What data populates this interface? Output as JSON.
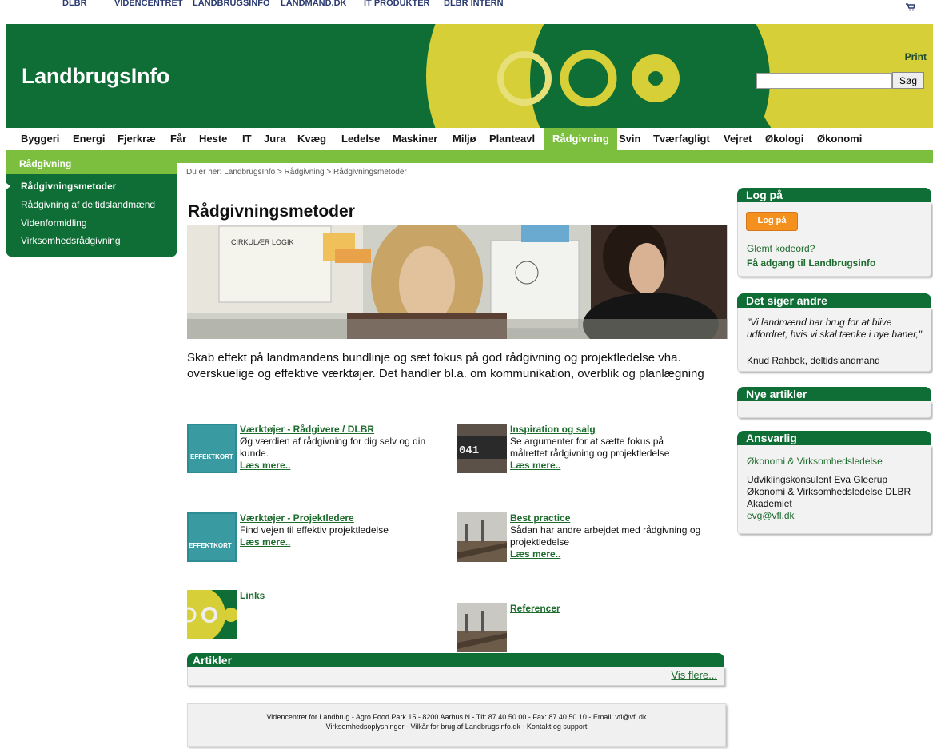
{
  "toplinks": [
    "DLBR",
    "Videncentret",
    "Landbrugsinfo",
    "Landmand.dk",
    "IT produkter",
    "DLBR Intern"
  ],
  "cart_icon": "cart-icon",
  "banner": {
    "logo": "LandbrugsInfo",
    "print": "Print",
    "search_value": "",
    "search_button": "Søg"
  },
  "nav": [
    "Byggeri",
    "Energi",
    "Fjerkræ",
    "Får",
    "Heste",
    "IT",
    "Jura",
    "Kvæg",
    "Ledelse",
    "Maskiner",
    "Miljø",
    "Planteavl",
    "Rådgivning",
    "Svin",
    "Tværfagligt",
    "Vejret",
    "Økologi",
    "Økonomi"
  ],
  "nav_active": "Rådgivning",
  "sidebar": {
    "heading": "Rådgivning",
    "items": [
      "Rådgivningsmetoder",
      "Rådgivning af deltidslandmænd",
      "Videnformidling",
      "Virksomhedsrådgivning"
    ]
  },
  "breadcrumb": "Du er her: LandbrugsInfo > Rådgivning > Rådgivningsmetoder",
  "page_title": "Rådgivningsmetoder",
  "intro": "Skab effekt på landmandens bundlinje og sæt fokus på god rådgivning og projektledelse vha. overskuelige og effektive værktøjer. Det handler bl.a. om kommunikation, overblik og planlægning",
  "cards": [
    {
      "title": "Værktøjer - Rådgivere / DLBR",
      "desc": "Øg værdien af rådgivning for dig selv og din kunde.",
      "more": "Læs mere..",
      "thumb_text": "EFFEKTKORT"
    },
    {
      "title": "Inspiration og salg",
      "desc": "Se argumenter for at sætte fokus på målrettet rådgivning og projektledelse",
      "more": "Læs mere..",
      "thumb_text": "041"
    },
    {
      "title": "Værktøjer - Projektledere",
      "desc": "Find vejen til effektiv projektledelse",
      "more": "Læs mere..",
      "thumb_text": "EFFEKTKORT"
    },
    {
      "title": "Best practice",
      "desc": "Sådan har andre arbejdet med rådgivning og projektledelse",
      "more": "Læs mere.."
    },
    {
      "title": "Links",
      "desc": "",
      "more": ""
    },
    {
      "title": "Referencer",
      "desc": "",
      "more": ""
    }
  ],
  "articles": {
    "heading": "Artikler",
    "more": "Vis flere..."
  },
  "footer": {
    "line1": "Videncentret for Landbrug - Agro Food Park 15 - 8200 Aarhus N - Tlf: 87 40 50 00 - Fax: 87 40 50 10 - Email:  vfl@vfl.dk",
    "line2": "Virksomhedsoplysninger - Vilkår for brug af Landbrugsinfo.dk - Kontakt og support"
  },
  "login": {
    "heading": "Log på",
    "button": "Log på",
    "forgot": "Glemt kodeord?",
    "access": "Få adgang til Landbrugsinfo"
  },
  "quote": {
    "heading": "Det siger andre",
    "text": "\"Vi landmænd har brug for at blive udfordret, hvis vi skal tænke i nye baner,\"",
    "author": "Knud Rahbek, deltidslandmand"
  },
  "news": {
    "heading": "Nye artikler"
  },
  "responsible": {
    "heading": "Ansvarlig",
    "dept": "Økonomi & Virksomhedsledelse",
    "person": "Udviklingskonsulent Eva Gleerup",
    "org": "Økonomi & Virksomhedsledelse DLBR Akademiet",
    "email": "evg@vfl.dk"
  },
  "colors": {
    "dark_green": "#0f6e35",
    "light_green": "#7cbf3f",
    "yellow": "#d6cf38",
    "orange": "#f4901d"
  }
}
